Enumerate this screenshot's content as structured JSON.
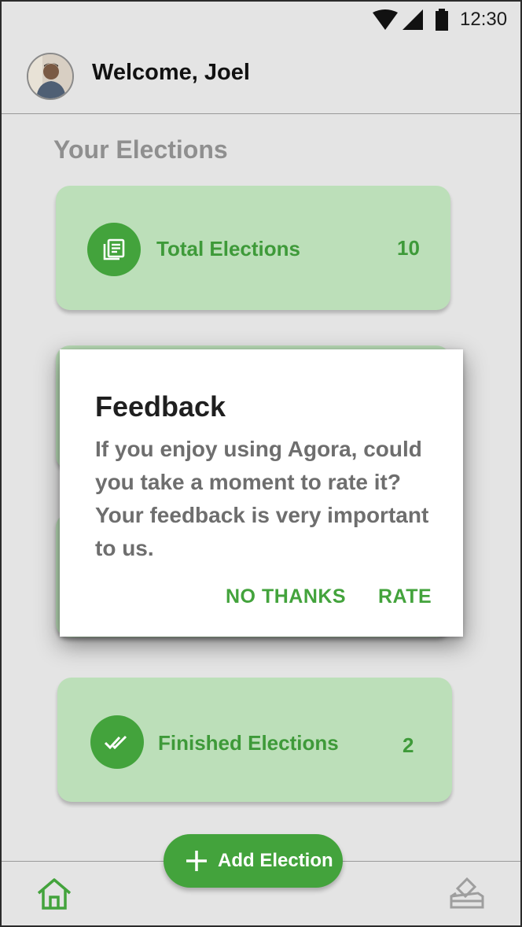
{
  "status_bar": {
    "time": "12:30",
    "icons": [
      "wifi-icon",
      "signal-icon",
      "battery-icon"
    ]
  },
  "header": {
    "welcome_text": "Welcome, Joel",
    "avatar": "user-avatar"
  },
  "section": {
    "title": "Your Elections"
  },
  "cards": [
    {
      "label": "Total Elections",
      "count": "10",
      "icon": "list-icon"
    },
    {
      "label": "Finished Elections",
      "count": "2",
      "icon": "double-check-icon"
    }
  ],
  "dialog": {
    "title": "Feedback",
    "message": "If you enjoy using Agora, could you take a moment to rate it? Your feedback is very important to us.",
    "negative_button": "NO THANKS",
    "positive_button": "RATE"
  },
  "fab": {
    "label": "Add Election",
    "icon": "plus-icon"
  },
  "bottom_nav": {
    "items": [
      "home-icon",
      "ballot-box-icon"
    ]
  },
  "colors": {
    "accent": "#43a33c",
    "card_bg": "#bcdfb9",
    "screen_bg": "#e4e4e4",
    "inactive_icon": "#9e9e9e"
  }
}
